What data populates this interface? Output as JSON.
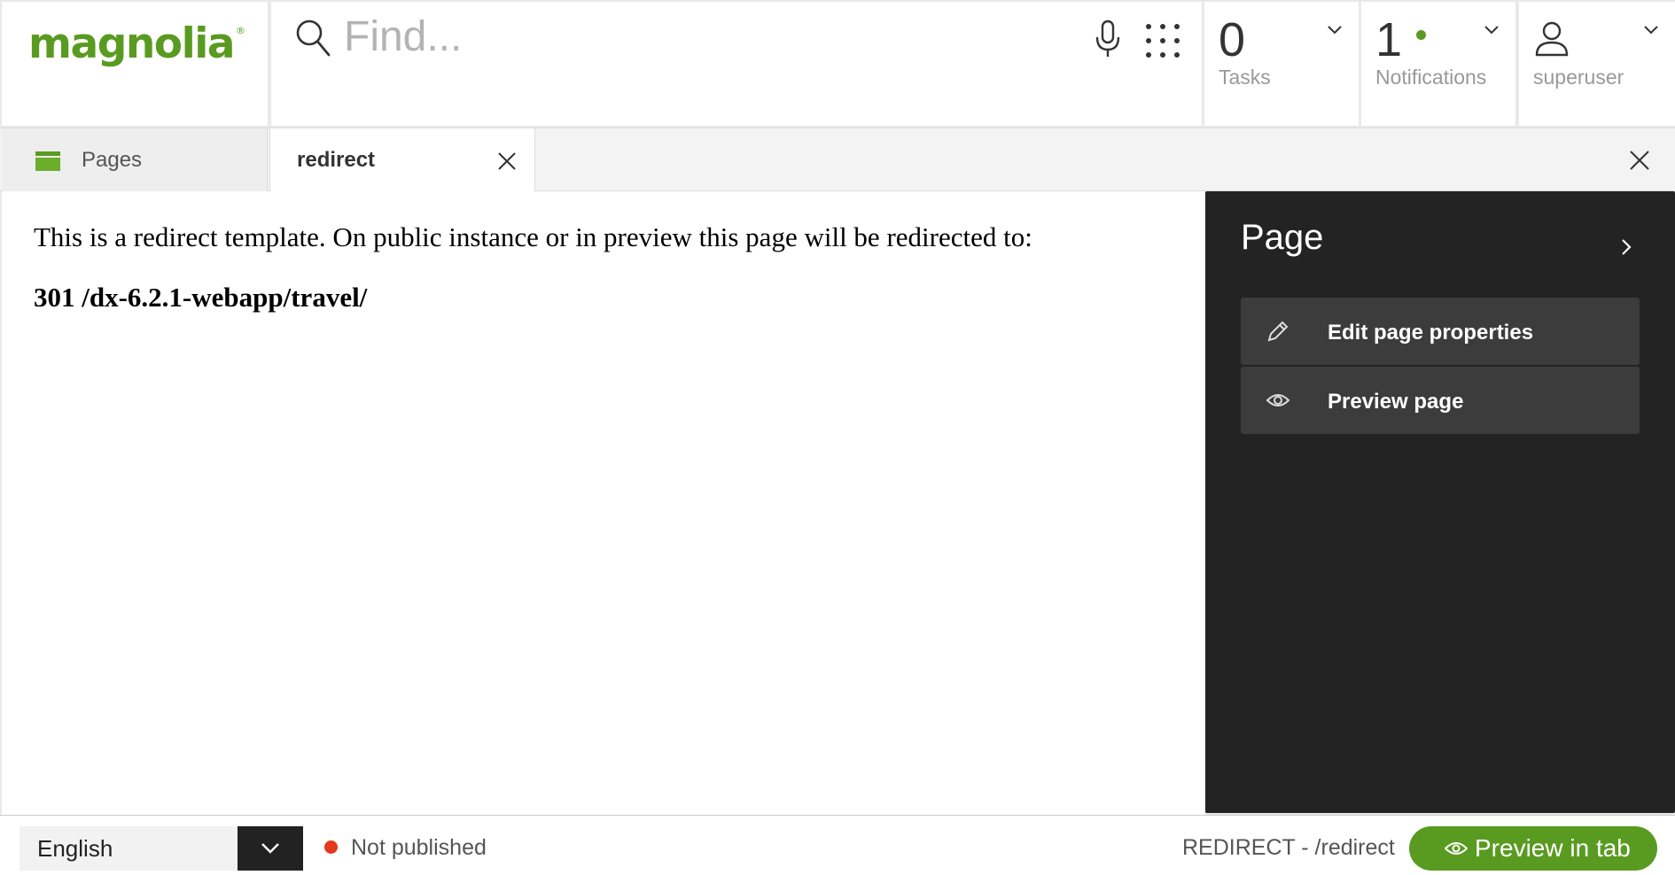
{
  "header": {
    "logo_text": "magnolia",
    "logo_mark": "®",
    "search": {
      "placeholder": "Find...",
      "icon": "search-icon"
    },
    "mic_icon": "mic-icon",
    "apps_icon": "apps-grid-icon",
    "tasks": {
      "count": "0",
      "label": "Tasks"
    },
    "notifications": {
      "count": "1",
      "label": "Notifications",
      "unread_indicator_color": "#599b20"
    },
    "user": {
      "label": "superuser",
      "icon": "user-icon"
    }
  },
  "tabs": [
    {
      "label": "Pages",
      "icon": "pages-folder-icon",
      "active": false
    },
    {
      "label": "redirect",
      "active": true,
      "closable": true
    }
  ],
  "content": {
    "message": "This is a redirect template. On public instance or in preview this page will be redirected to:",
    "target": "301 /dx-6.2.1-webapp/travel/"
  },
  "action_panel": {
    "title": "Page",
    "actions": [
      {
        "label": "Edit page properties",
        "icon": "pencil-icon"
      },
      {
        "label": "Preview page",
        "icon": "eye-icon"
      }
    ]
  },
  "footer": {
    "language": "English",
    "status": {
      "text": "Not published",
      "color": "#e4381f"
    },
    "path": "REDIRECT - /redirect",
    "preview_button": "Preview in tab"
  },
  "colors": {
    "brand": "#599b20",
    "panel_bg": "#232323",
    "action_bg": "#3c3c3c"
  }
}
